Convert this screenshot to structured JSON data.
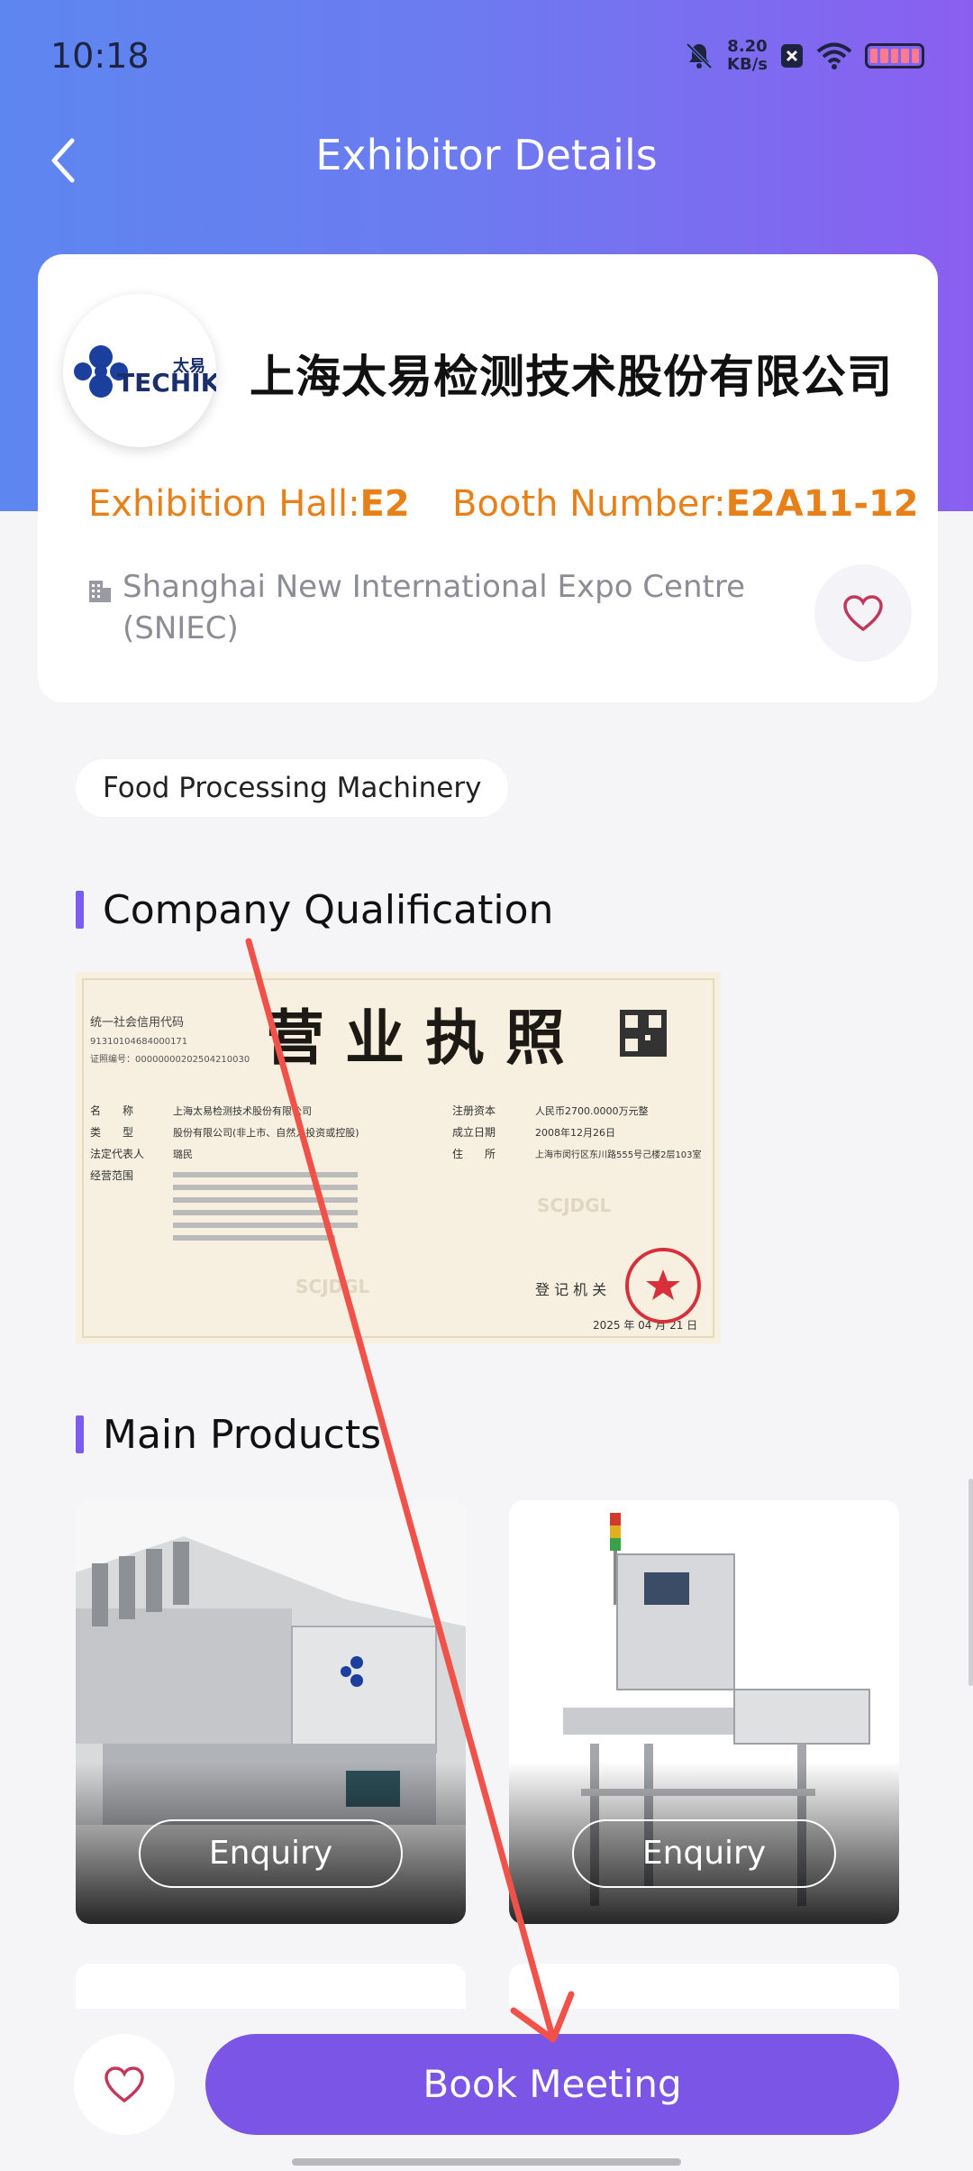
{
  "status_bar": {
    "time": "10:18",
    "net_speed_value": "8.20",
    "net_speed_unit": "KB/s"
  },
  "nav": {
    "title": "Exhibitor Details"
  },
  "exhibitor": {
    "company_name": "上海太易检测技术股份有限公司",
    "logo_brand": "TECHIK",
    "logo_cn": "太易",
    "hall_label": "Exhibition Hall:",
    "hall_value": "E2",
    "booth_label": "Booth Number:",
    "booth_value": "E2A11-12",
    "address": "Shanghai New International Expo Centre (SNIEC)"
  },
  "tags": [
    "Food Processing Machinery"
  ],
  "sections": {
    "qualification_title": "Company Qualification",
    "products_title": "Main Products"
  },
  "license": {
    "title": "营 业 执 照",
    "credit_code_label": "统一社会信用代码",
    "credit_code": "91310104684000171",
    "cert_no": "证照编号：00000000202504210030",
    "name_label": "名　　称",
    "name_value": "上海太易检测技术股份有限公司",
    "type_label": "类　　型",
    "type_value": "股份有限公司(非上市、自然人投资或控股)",
    "rep_label": "法定代表人",
    "rep_value": "璐民",
    "scope_label": "经营范围",
    "capital_label": "注册资本",
    "capital_value": "人民币2700.0000万元整",
    "date_label": "成立日期",
    "date_value": "2008年12月26日",
    "address_label": "住　　所",
    "address_value": "上海市闵行区东川路555号己楼2层103室",
    "authority_label": "登 记 机 关",
    "issue_date": "2025 年 04 月 21 日",
    "watermark": "SCJDGL"
  },
  "products": [
    {
      "enquiry_label": "Enquiry"
    },
    {
      "enquiry_label": "Enquiry"
    }
  ],
  "bottom_bar": {
    "book_label": "Book Meeting"
  },
  "colors": {
    "accent_purple": "#7b55e6",
    "orange": "#e8801a",
    "heart": "#c0395a",
    "annotation_red": "#f0524a"
  }
}
